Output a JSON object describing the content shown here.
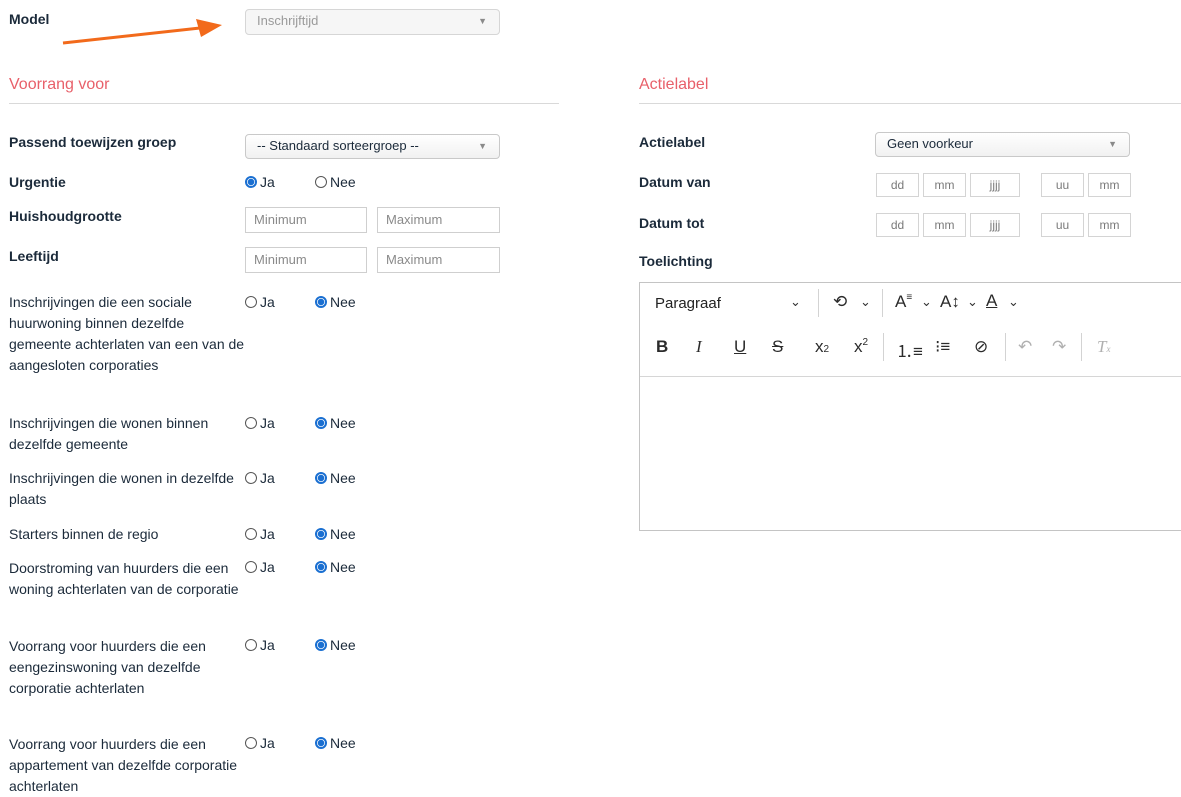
{
  "model": {
    "label": "Model",
    "select_value": "Inschrijftijd"
  },
  "voorrang": {
    "title": "Voorrang voor",
    "group_label": "Passend toewijzen groep",
    "group_value": "-- Standaard sorteergroep --",
    "urgentie_label": "Urgentie",
    "household_label": "Huishoudgrootte",
    "age_label": "Leeftijd",
    "min_placeholder": "Minimum",
    "max_placeholder": "Maximum",
    "yes": "Ja",
    "no": "Nee",
    "questions": [
      {
        "text": "Inschrijvingen die een sociale huurwoning binnen dezelfde gemeente achterlaten van een van de aangesloten corporaties"
      },
      {
        "text": "Inschrijvingen die wonen binnen dezelfde gemeente"
      },
      {
        "text": "Inschrijvingen die wonen in dezelfde plaats"
      },
      {
        "text": "Starters binnen de regio"
      },
      {
        "text": "Doorstroming van huurders die een woning achterlaten van de corporatie"
      },
      {
        "text": "Voorrang voor huurders die een eengezinswoning van dezelfde corporatie achterlaten"
      },
      {
        "text": "Voorrang voor huurders die een appartement van dezelfde corporatie achterlaten"
      }
    ]
  },
  "actielabel": {
    "title": "Actielabel",
    "label": "Actielabel",
    "select_value": "Geen voorkeur",
    "date_from_label": "Datum van",
    "date_to_label": "Datum tot",
    "ph_dd": "dd",
    "ph_mm": "mm",
    "ph_jjjj": "jjjj",
    "ph_uu": "uu",
    "toelichting_label": "Toelichting",
    "editor": {
      "paragraph": "Paragraaf"
    }
  }
}
